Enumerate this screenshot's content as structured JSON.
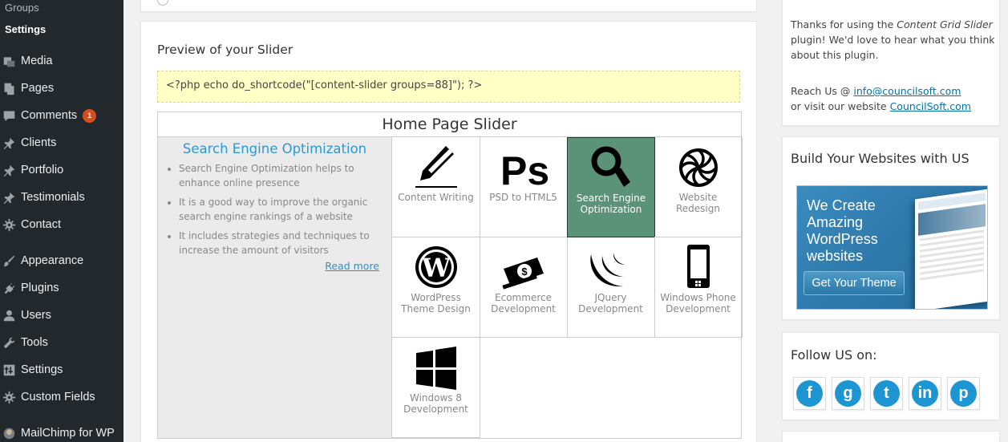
{
  "sidebar": {
    "submenu": [
      {
        "label": "Groups",
        "current": false
      },
      {
        "label": "Settings",
        "current": true
      }
    ],
    "items": [
      {
        "label": "Media",
        "icon": "media-icon"
      },
      {
        "label": "Pages",
        "icon": "pages-icon"
      },
      {
        "label": "Comments",
        "icon": "comments-icon",
        "badge": "1"
      },
      {
        "label": "Clients",
        "icon": "pin-icon"
      },
      {
        "label": "Portfolio",
        "icon": "pin-icon"
      },
      {
        "label": "Testimonials",
        "icon": "pin-icon"
      },
      {
        "label": "Contact",
        "icon": "gear-icon"
      },
      {
        "label": "Appearance",
        "icon": "brush-icon"
      },
      {
        "label": "Plugins",
        "icon": "plug-icon"
      },
      {
        "label": "Users",
        "icon": "user-icon"
      },
      {
        "label": "Tools",
        "icon": "wrench-icon"
      },
      {
        "label": "Settings",
        "icon": "settings-icon"
      },
      {
        "label": "Custom Fields",
        "icon": "gear-icon"
      },
      {
        "label": "MailChimp for WP",
        "icon": "mailchimp-icon"
      }
    ]
  },
  "preview": {
    "title": "Preview of your Slider",
    "shortcode": "<?php echo do_shortcode(\"[content-slider groups=88]\"); ?>",
    "slider": {
      "title": "Home Page Slider",
      "slide": {
        "heading": "Search Engine Optimization",
        "points": [
          "Search Engine Optimization helps to enhance online presence",
          "It is a good way to improve the organic search engine rankings of a website",
          "It includes strategies and techniques to increase the amount of visitors"
        ],
        "read_more": "Read more"
      },
      "tiles": [
        {
          "label": "Content Writing",
          "icon": "pencil-icon",
          "active": false
        },
        {
          "label": "PSD to HTML5",
          "icon": "photoshop-icon",
          "active": false
        },
        {
          "label": "Search Engine Optimization",
          "icon": "magnifier-icon",
          "active": true
        },
        {
          "label": "Website Redesign",
          "icon": "aperture-icon",
          "active": false
        },
        {
          "label": "WordPress Theme Design",
          "icon": "wordpress-icon",
          "active": false
        },
        {
          "label": "Ecommerce Development",
          "icon": "money-icon",
          "active": false
        },
        {
          "label": "JQuery Development",
          "icon": "jquery-icon",
          "active": false
        },
        {
          "label": "Windows Phone Development",
          "icon": "windows-phone-icon",
          "active": false
        },
        {
          "label": "Windows 8 Development",
          "icon": "windows-icon",
          "active": false
        }
      ]
    }
  },
  "thanks": {
    "line1": "Thanks for using the ",
    "plugin_name": "Content Grid Slider",
    "line2": " plugin! We'd love to hear what you think about this plugin.",
    "reach_prefix": "Reach Us @ ",
    "email": "info@councilsoft.com",
    "visit_prefix": "or visit our website ",
    "website": "CouncilSoft.com"
  },
  "build": {
    "title": "Build Your Websites with US",
    "banner_text": "We Create Amazing WordPress websites",
    "banner_button": "Get Your Theme"
  },
  "follow": {
    "title": "Follow US on:",
    "networks": [
      {
        "name": "facebook",
        "glyph": "f"
      },
      {
        "name": "google-plus",
        "glyph": "g"
      },
      {
        "name": "twitter",
        "glyph": "t"
      },
      {
        "name": "linkedin",
        "glyph": "in"
      },
      {
        "name": "pinterest",
        "glyph": "p"
      }
    ]
  },
  "colors": {
    "sidebar_bg": "#23282d",
    "badge": "#d54e21",
    "accent_link": "#2e97d3",
    "active_tile": "#5a9378",
    "shortcode_bg": "#ffffc6",
    "social": "#1d95d2"
  }
}
